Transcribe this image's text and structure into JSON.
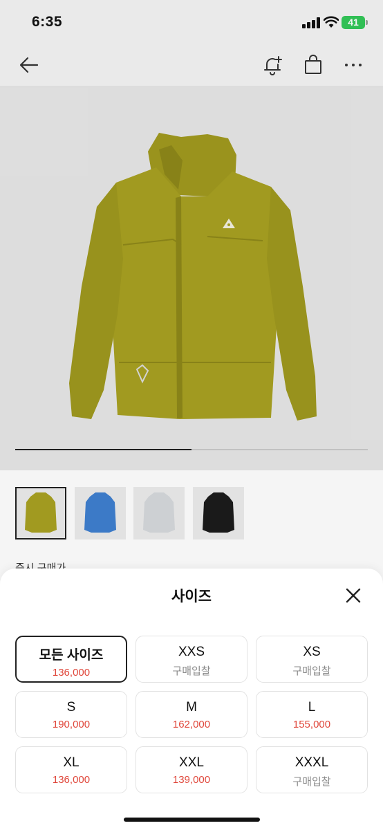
{
  "status_bar": {
    "time": "6:35",
    "battery": "41"
  },
  "header": {
    "back_icon": "arrow-left-icon",
    "alert_icon": "bell-plus-icon",
    "bag_icon": "shopping-bag-icon",
    "more_icon": "more-horizontal-icon"
  },
  "gallery": {
    "progress": 0.5,
    "thumbnail_count": 4,
    "selected_index": 0
  },
  "below_gallery_label": "즉시 구매가",
  "size_sheet": {
    "title": "사이즈",
    "close_icon": "close-icon",
    "sizes": [
      {
        "name": "모든 사이즈",
        "price": "136,000",
        "selected": true
      },
      {
        "name": "XXS",
        "price": "구매입찰",
        "selected": false
      },
      {
        "name": "XS",
        "price": "구매입찰",
        "selected": false
      },
      {
        "name": "S",
        "price": "190,000",
        "selected": false
      },
      {
        "name": "M",
        "price": "162,000",
        "selected": false
      },
      {
        "name": "L",
        "price": "155,000",
        "selected": false
      },
      {
        "name": "XL",
        "price": "136,000",
        "selected": false
      },
      {
        "name": "XXL",
        "price": "139,000",
        "selected": false
      },
      {
        "name": "XXXL",
        "price": "구매입찰",
        "selected": false
      }
    ]
  },
  "colors": {
    "accent_price": "#e0473b",
    "muted_price": "#8a8a8a",
    "jacket_main": "#a8a122"
  }
}
